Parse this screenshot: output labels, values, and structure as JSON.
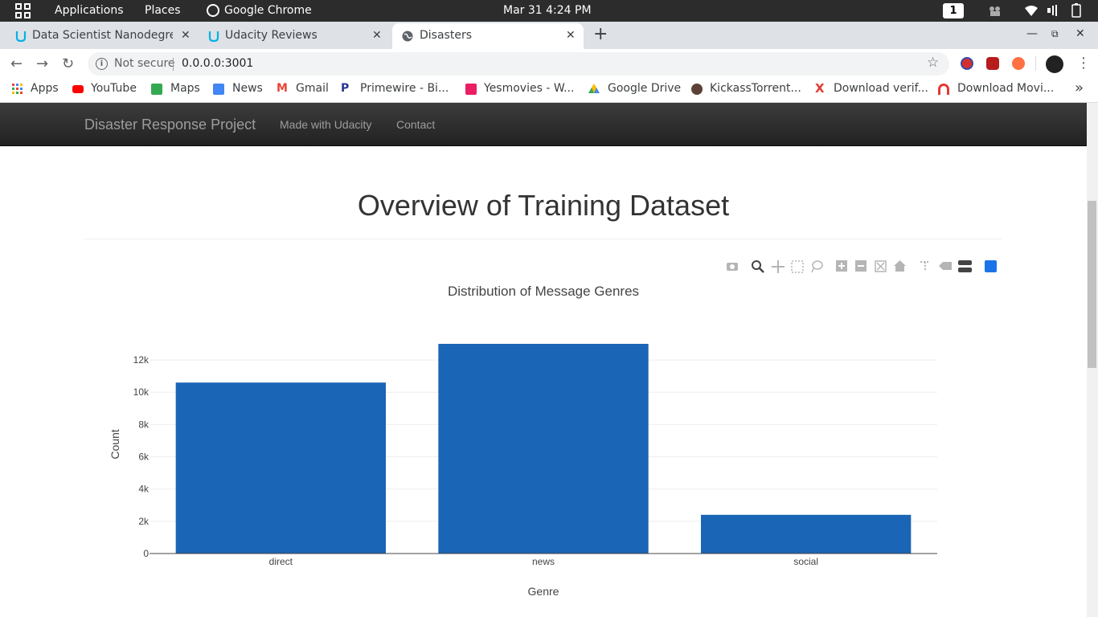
{
  "system_bar": {
    "applications": "Applications",
    "places": "Places",
    "active_app": "Google Chrome",
    "clock": "Mar 31   4:24 PM",
    "workspace": "1"
  },
  "browser": {
    "tabs": [
      {
        "label": "Data Scientist Nanodegre",
        "icon": "udacity-icon",
        "active": false
      },
      {
        "label": "Udacity Reviews",
        "icon": "udacity-icon",
        "active": false
      },
      {
        "label": "Disasters",
        "icon": "globe-icon",
        "active": true
      }
    ],
    "security_label": "Not secure",
    "url": "0.0.0.0:3001",
    "bookmarks": [
      {
        "label": "Apps",
        "icon": "apps-grid-icon"
      },
      {
        "label": "YouTube",
        "icon": "youtube-icon"
      },
      {
        "label": "Maps",
        "icon": "maps-icon"
      },
      {
        "label": "News",
        "icon": "google-news-icon"
      },
      {
        "label": "Gmail",
        "icon": "gmail-icon"
      },
      {
        "label": "Primewire - Bi...",
        "icon": "primewire-icon"
      },
      {
        "label": "Yesmovies - W...",
        "icon": "yesmovies-icon"
      },
      {
        "label": "Google Drive",
        "icon": "google-drive-icon"
      },
      {
        "label": "KickassTorrent...",
        "icon": "kickass-icon"
      },
      {
        "label": "Download verif...",
        "icon": "x-icon"
      },
      {
        "label": "Download Movi...",
        "icon": "download-movie-icon"
      }
    ],
    "more_bookmarks": "»"
  },
  "navbar": {
    "brand": "Disaster Response Project",
    "links": [
      "Made with Udacity",
      "Contact"
    ]
  },
  "page": {
    "title": "Overview of Training Dataset"
  },
  "chart_data": {
    "type": "bar",
    "title": "Distribution of Message Genres",
    "xlabel": "Genre",
    "ylabel": "Count",
    "categories": [
      "direct",
      "news",
      "social"
    ],
    "values": [
      10600,
      13000,
      2400
    ],
    "ylim": [
      0,
      13000
    ],
    "yticks": [
      0,
      2000,
      4000,
      6000,
      8000,
      10000,
      12000
    ],
    "ytick_labels": [
      "0",
      "2k",
      "4k",
      "6k",
      "8k",
      "10k",
      "12k"
    ],
    "bar_color": "#1a65b5",
    "grid": true
  }
}
